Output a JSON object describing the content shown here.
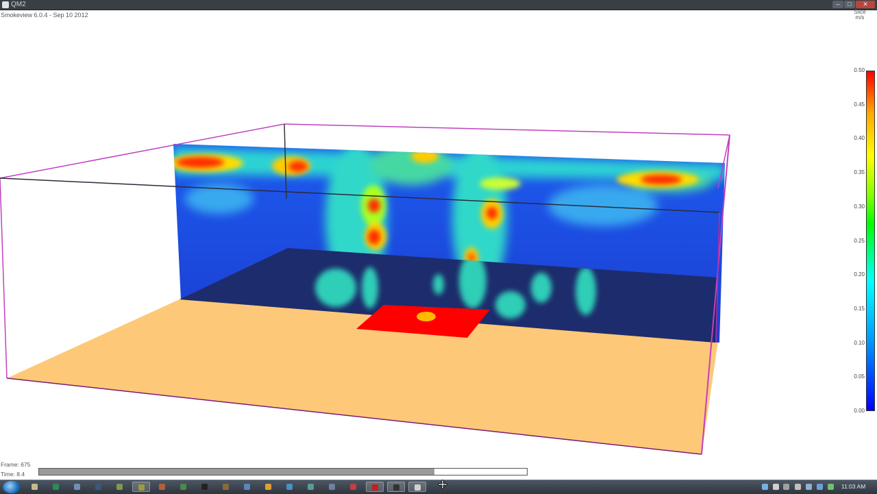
{
  "window": {
    "title": "QM2"
  },
  "overlay": {
    "version_text": "Smokeview 6.0.4 - Sep 10 2012",
    "slice_label_line1": "Slice",
    "slice_label_line2": "m/s"
  },
  "colorbar": {
    "ticks": [
      "0.50",
      "0.45",
      "0.40",
      "0.35",
      "0.30",
      "0.25",
      "0.20",
      "0.15",
      "0.10",
      "0.05",
      "0.00"
    ]
  },
  "playback": {
    "frame_text": "Frame: 675",
    "time_text": "Time: 8.4",
    "progress": 0.81
  },
  "taskbar": {
    "clock": "11:03 AM",
    "apps": [
      {
        "icon": "folder-icon",
        "color": "#c9b98a",
        "active": false
      },
      {
        "icon": "excel-icon",
        "color": "#2e8b57",
        "active": false
      },
      {
        "icon": "document-icon",
        "color": "#6f8fb3",
        "active": false
      },
      {
        "icon": "terminal-icon",
        "color": "#3a5a7a",
        "active": false
      },
      {
        "icon": "app-icon",
        "color": "#7a9b4d",
        "active": false
      },
      {
        "icon": "app-icon",
        "color": "#9b9b3d",
        "active": true
      },
      {
        "icon": "app-icon",
        "color": "#b06040",
        "active": false
      },
      {
        "icon": "app-icon",
        "color": "#4a8a4a",
        "active": false
      },
      {
        "icon": "camera-icon",
        "color": "#222222",
        "active": false
      },
      {
        "icon": "app-icon",
        "color": "#8a6a3a",
        "active": false
      },
      {
        "icon": "calendar-icon",
        "color": "#5b86b8",
        "active": false
      },
      {
        "icon": "chrome-icon",
        "color": "#e0a030",
        "active": false
      },
      {
        "icon": "app-icon",
        "color": "#4a90c0",
        "active": false
      },
      {
        "icon": "app-icon",
        "color": "#5a9a9a",
        "active": false
      },
      {
        "icon": "app-icon",
        "color": "#7080a0",
        "active": false
      },
      {
        "icon": "app-icon",
        "color": "#c04040",
        "active": false
      },
      {
        "icon": "pdf-icon",
        "color": "#c02020",
        "active": true
      },
      {
        "icon": "app-icon",
        "color": "#333333",
        "active": true
      },
      {
        "icon": "smokeview-icon",
        "color": "#d0d0d0",
        "active": true
      }
    ]
  }
}
